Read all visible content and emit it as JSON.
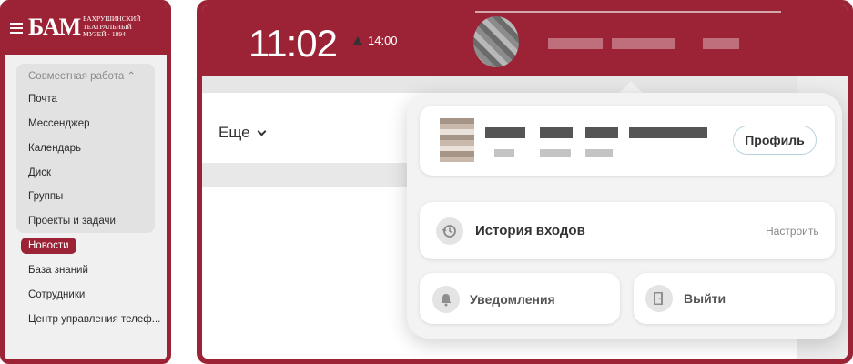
{
  "sidebar": {
    "logo_mark": "БАМ",
    "logo_text": [
      "БАХРУШИНСКИЙ",
      "ТЕАТРАЛЬНЫЙ",
      "МУЗЕЙ · 1894"
    ],
    "group_title": "Совместная работа ⌃",
    "items": [
      {
        "label": "Почта"
      },
      {
        "label": "Мессенджер"
      },
      {
        "label": "Календарь"
      },
      {
        "label": "Диск"
      },
      {
        "label": "Группы"
      },
      {
        "label": "Проекты и задачи"
      }
    ],
    "active_item": "Новости",
    "items_after": [
      {
        "label": "База знаний"
      },
      {
        "label": "Сотрудники"
      },
      {
        "label": "Центр управления телеф..."
      }
    ]
  },
  "topbar": {
    "clock": "11:02",
    "alarm": "14:00"
  },
  "main": {
    "more_label": "Еще"
  },
  "popup": {
    "profile_button": "Профиль",
    "history_label": "История входов",
    "setup_link": "Настроить",
    "notifications_label": "Уведомления",
    "logout_label": "Выйти"
  },
  "colors": {
    "brand": "#9b2335",
    "popup_bg": "#f3f3f3"
  },
  "icons": [
    "menu-icon",
    "history-icon",
    "bell-icon",
    "door-icon",
    "chevron-down-icon",
    "alarm-icon"
  ]
}
